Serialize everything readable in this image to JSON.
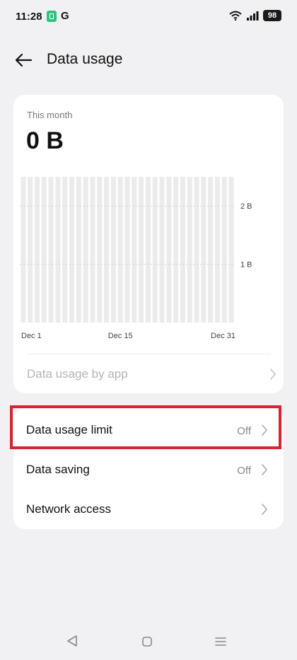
{
  "status_bar": {
    "time": "11:28",
    "carrier_letter": "G",
    "battery_level": "98",
    "icons": [
      "battery-saver-icon",
      "wifi-icon",
      "signal-icon",
      "battery-icon"
    ]
  },
  "header": {
    "title": "Data usage",
    "back_icon": "arrow-left-icon"
  },
  "usage": {
    "period_label": "This month",
    "total": "0 B"
  },
  "chart_data": {
    "type": "bar",
    "days": 31,
    "values": [
      0,
      0,
      0,
      0,
      0,
      0,
      0,
      0,
      0,
      0,
      0,
      0,
      0,
      0,
      0,
      0,
      0,
      0,
      0,
      0,
      0,
      0,
      0,
      0,
      0,
      0,
      0,
      0,
      0,
      0,
      0
    ],
    "ylim": [
      0,
      2.5
    ],
    "yticks": [
      {
        "value": 2,
        "label": "2 B"
      },
      {
        "value": 1,
        "label": "1 B"
      }
    ],
    "xtick_labels": [
      "Dec 1",
      "Dec 15",
      "Dec 31"
    ],
    "bar_color": "#ebebeb",
    "grid": true
  },
  "app_usage": {
    "label": "Data usage by app"
  },
  "settings": [
    {
      "label": "Data usage limit",
      "value": "Off"
    },
    {
      "label": "Data saving",
      "value": "Off"
    },
    {
      "label": "Network access",
      "value": ""
    }
  ],
  "nav_bar": {
    "icons": [
      "nav-back-icon",
      "nav-home-icon",
      "nav-menu-icon"
    ]
  },
  "colors": {
    "background": "#f1f1f3",
    "card": "#ffffff",
    "highlight": "#d9232e"
  }
}
